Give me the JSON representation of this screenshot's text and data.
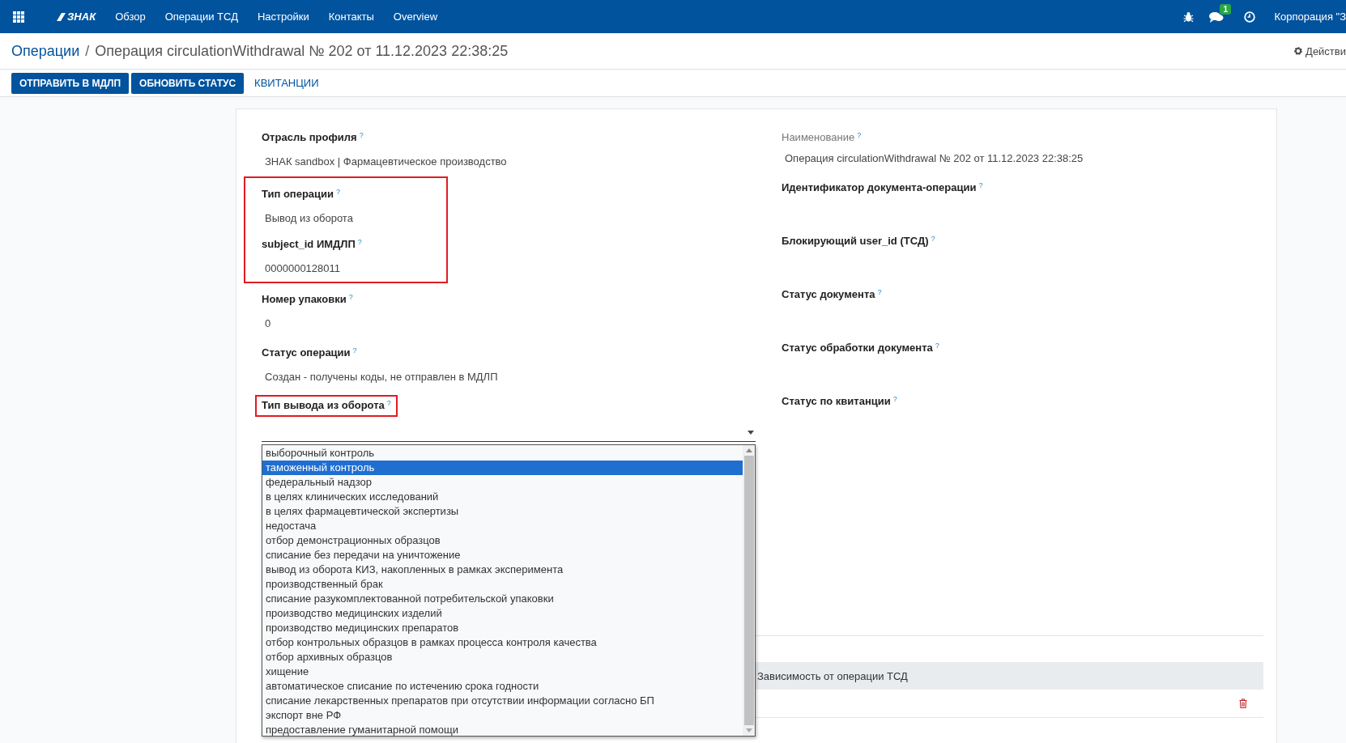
{
  "navbar": {
    "logo_text": "ЗНАК",
    "menu": [
      {
        "label": "Обзор"
      },
      {
        "label": "Операции ТСД"
      },
      {
        "label": "Настройки"
      },
      {
        "label": "Контакты"
      },
      {
        "label": "Overview"
      }
    ],
    "messages_badge": "1",
    "company": "Корпорация \"З"
  },
  "breadcrumb": {
    "parent": "Операции",
    "separator": "/",
    "current": "Операция circulationWithdrawal № 202 от 11.12.2023 22:38:25",
    "actions": "Действи"
  },
  "buttons": [
    {
      "label": "ОТПРАВИТЬ В МДЛП",
      "kind": "primary"
    },
    {
      "label": "ОБНОВИТЬ СТАТУС",
      "kind": "primary"
    },
    {
      "label": "КВИТАНЦИИ",
      "kind": "link"
    }
  ],
  "left_fields": [
    {
      "label": "Отрасль профиля",
      "hint": "?",
      "value": "ЗНАК sandbox | Фармацевтическое производство",
      "highlighted": false
    },
    {
      "label": "Тип операции",
      "hint": "?",
      "value": "Вывод из оборота",
      "highlighted": true
    },
    {
      "label": "subject_id ИМДЛП",
      "hint": "?",
      "value": "0000000128011",
      "highlighted": true
    },
    {
      "label": "Номер упаковки",
      "hint": "?",
      "value": "0",
      "highlighted": false
    },
    {
      "label": "Статус операции",
      "hint": "?",
      "value": "Создан - получены коды, не отправлен в МДЛП",
      "highlighted": false
    }
  ],
  "withdrawal_type": {
    "label": "Тип вывода из оборота",
    "hint": "?",
    "label_highlighted": true,
    "expanded": true,
    "options": [
      {
        "label": "выборочный контроль",
        "selected": false
      },
      {
        "label": "таможенный контроль",
        "selected": true
      },
      {
        "label": "федеральный надзор",
        "selected": false
      },
      {
        "label": "в целях клинических исследований",
        "selected": false
      },
      {
        "label": "в целях фармацевтической экспертизы",
        "selected": false
      },
      {
        "label": "недостача",
        "selected": false
      },
      {
        "label": "отбор демонстрационных образцов",
        "selected": false
      },
      {
        "label": "списание без передачи на уничтожение",
        "selected": false
      },
      {
        "label": "вывод из оборота КИЗ, накопленных в рамках эксперимента",
        "selected": false
      },
      {
        "label": "производственный брак",
        "selected": false
      },
      {
        "label": "списание разукомплектованной потребительской упаковки",
        "selected": false
      },
      {
        "label": "производство медицинских изделий",
        "selected": false
      },
      {
        "label": "производство медицинских препаратов",
        "selected": false
      },
      {
        "label": "отбор контрольных образцов в рамках процесса контроля качества",
        "selected": false
      },
      {
        "label": "отбор архивных образцов",
        "selected": false
      },
      {
        "label": "хищение",
        "selected": false
      },
      {
        "label": "автоматическое списание по истечению срока годности",
        "selected": false
      },
      {
        "label": "списание лекарственных препаратов при отсутствии информации согласно БП",
        "selected": false
      },
      {
        "label": "экспорт вне РФ",
        "selected": false
      },
      {
        "label": "предоставление гуманитарной помощи",
        "selected": false
      }
    ]
  },
  "right_fields": [
    {
      "label": "Наименование",
      "hint": "?",
      "value": "Операция circulationWithdrawal № 202 от 11.12.2023 22:38:25",
      "muted": true
    },
    {
      "label": "Идентификатор документа-операции",
      "hint": "?",
      "muted": false
    },
    {
      "label": "Блокирующий user_id (ТСД)",
      "hint": "?",
      "muted": false
    },
    {
      "label": "Статус документа",
      "hint": "?",
      "muted": false
    },
    {
      "label": "Статус обработки документа",
      "hint": "?",
      "muted": false
    },
    {
      "label": "Статус по квитанции",
      "hint": "?",
      "muted": false
    }
  ],
  "lines_table": {
    "column_2": "Зависимость от операции ТСД"
  }
}
